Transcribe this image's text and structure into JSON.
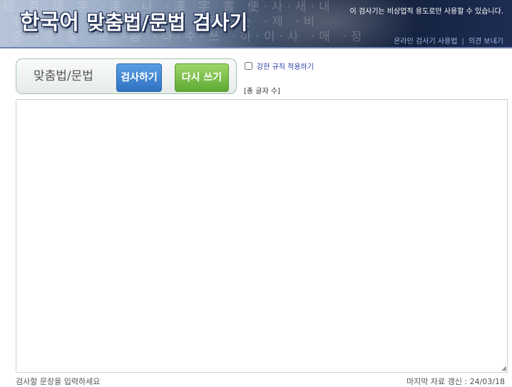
{
  "header": {
    "title_part1": "한국어 ",
    "title_part2": "맞춤법/문법 검사기",
    "notice": "이 검사기는 비상업적 용도로만 사용할 수 있습니다.",
    "link_usage": "온라인 검사기 사용법",
    "link_separator": "|",
    "link_feedback": "의견 보내기",
    "bg_glyphs": [
      "經 百 語 字 ·漢 ·나 ·漢 字 書 便·사·새·내",
      "·수·옷 ·이 ·란 ·시·이·린 ·르 ·는 ·제 ·비",
      "·중 ·생·홀 ·로 ·씀 ·다·수·쓰 ·하·이·사 ·매 ·정"
    ]
  },
  "controls": {
    "mode_label": "맞춤법/문법",
    "check_button": "검사하기",
    "reset_button": "다시 쓰기",
    "strict_rule_label": "강한 규칙 적용하기",
    "strict_rule_checked": false,
    "char_count_label": "[총 글자 수]"
  },
  "editor": {
    "value": "",
    "resize_grip": "◢"
  },
  "footer": {
    "hint": "검사할 문장을 입력하세요",
    "last_update": "마지막 자료 갱신 : 24/03/18"
  },
  "colors": {
    "check_button": "#3a80cf",
    "reset_button": "#72bb45",
    "header_dark": "#14223f",
    "strict_label": "#2a3fa8"
  }
}
